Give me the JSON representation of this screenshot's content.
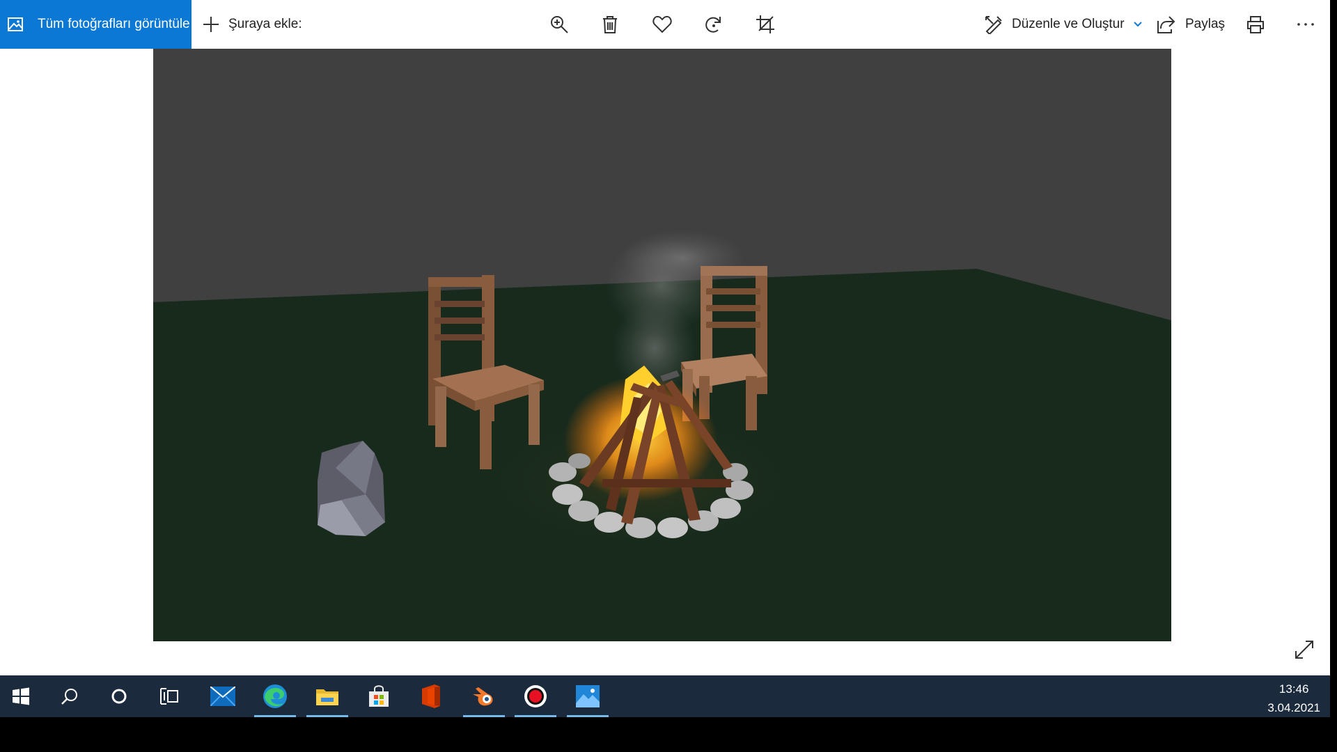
{
  "toolbar": {
    "view_all_label": "Tüm fotoğrafları görüntüle",
    "add_to_label": "Şuraya ekle:",
    "edit_create_label": "Düzenle ve Oluştur",
    "share_label": "Paylaş",
    "accent_color": "#0a78d4"
  },
  "icons": [
    "photos-icon",
    "plus-icon",
    "zoom-icon",
    "delete-icon",
    "favorite-icon",
    "rotate-icon",
    "crop-icon",
    "edit-create-icon",
    "chevron-down-icon",
    "share-icon",
    "print-icon",
    "more-icon",
    "expand-icon"
  ],
  "taskbar": {
    "time": "13:46",
    "date": "3.04.2021",
    "apps": [
      "start",
      "search",
      "cortana",
      "task-view",
      "mail",
      "edge",
      "file-explorer",
      "store",
      "office",
      "blender",
      "recorder",
      "photos"
    ],
    "background": "#1c2a3e"
  },
  "photo": {
    "wall_color": "#404040",
    "floor_color": "#172a1c"
  }
}
